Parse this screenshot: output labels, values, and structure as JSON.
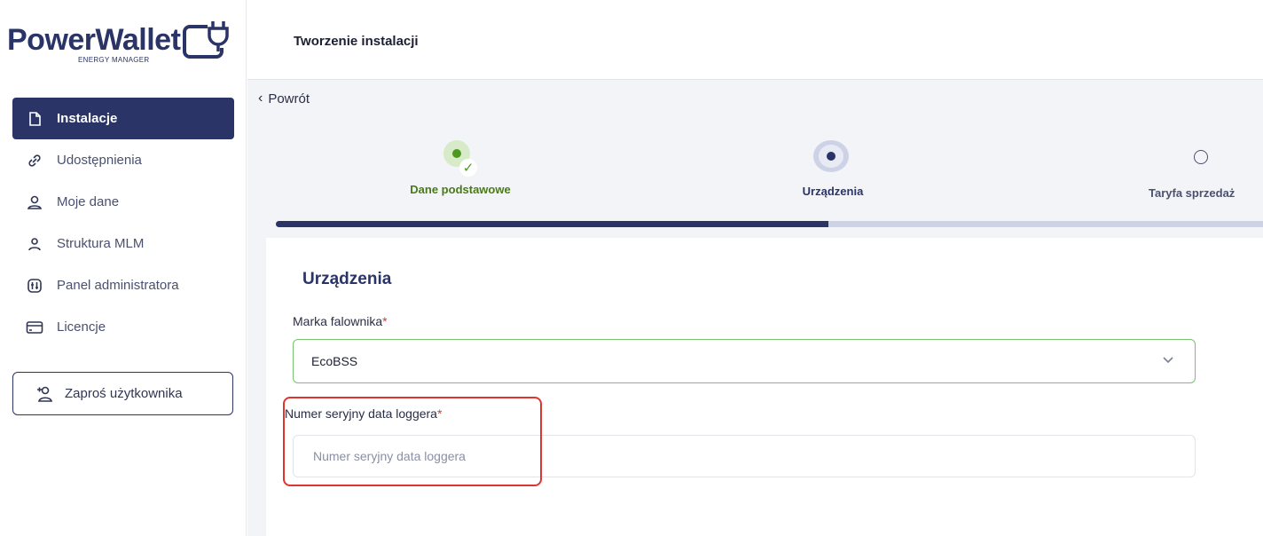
{
  "brand": {
    "name": "PowerWallet",
    "tagline": "ENERGY MANAGER"
  },
  "sidebar": {
    "items": [
      {
        "label": "Instalacje",
        "icon": "document-icon",
        "active": true
      },
      {
        "label": "Udostępnienia",
        "icon": "link-icon",
        "active": false
      },
      {
        "label": "Moje dane",
        "icon": "user-icon",
        "active": false
      },
      {
        "label": "Struktura MLM",
        "icon": "person-icon",
        "active": false
      },
      {
        "label": "Panel administratora",
        "icon": "admin-panel-icon",
        "active": false
      },
      {
        "label": "Licencje",
        "icon": "card-icon",
        "active": false
      }
    ],
    "invite_label": "Zaproś użytkownika"
  },
  "header": {
    "title": "Tworzenie instalacji"
  },
  "main": {
    "back_label": "Powrót",
    "steps": [
      {
        "label": "Dane podstawowe",
        "state": "completed"
      },
      {
        "label": "Urządzenia",
        "state": "current"
      },
      {
        "label": "Taryfa sprzedaż",
        "state": "pending"
      }
    ],
    "progress": 0.56,
    "section_title": "Urządzenia",
    "inverter_brand": {
      "label": "Marka falownika",
      "required_mark": "*",
      "value": "EcoBSS"
    },
    "logger_serial": {
      "label": "Numer seryjny data loggera",
      "required_mark": "*",
      "placeholder": "Numer seryjny data loggera",
      "value": ""
    }
  },
  "colors": {
    "primary": "#2a3466",
    "success": "#4b9a1f",
    "required": "#e0342f",
    "highlight": "#e0342f"
  }
}
